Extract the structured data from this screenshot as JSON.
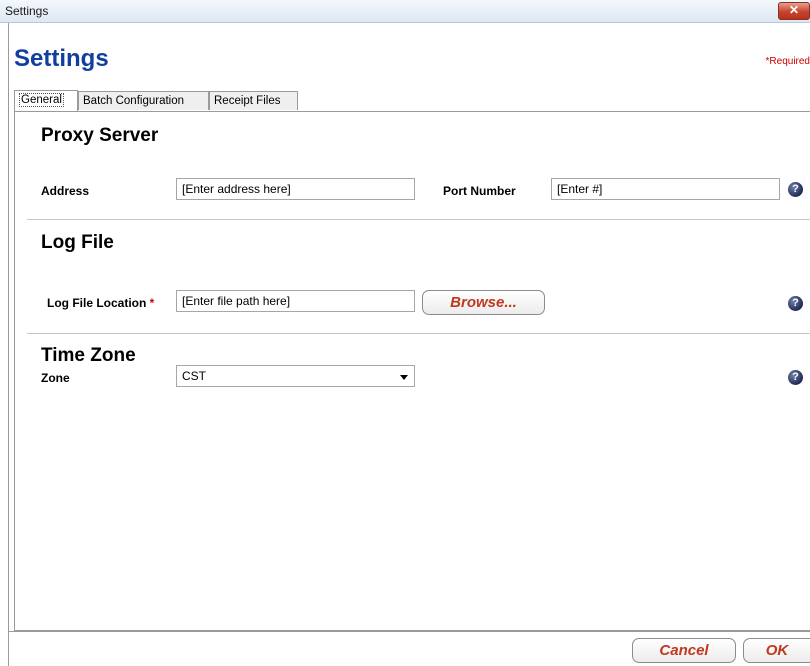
{
  "window": {
    "title": "Settings",
    "close_symbol": "✕"
  },
  "header": {
    "title": "Settings",
    "required_note": "*Required"
  },
  "tabs": [
    {
      "label": "General",
      "active": true
    },
    {
      "label": "Batch Configuration",
      "active": false
    },
    {
      "label": "Receipt Files",
      "active": false
    }
  ],
  "proxy": {
    "title": "Proxy Server",
    "address_label": "Address",
    "address_placeholder": "[Enter address here]",
    "port_label": "Port Number",
    "port_placeholder": "[Enter #]"
  },
  "log": {
    "title": "Log File",
    "location_label": "Log File Location",
    "required_mark": "*",
    "location_placeholder": "[Enter file path here]",
    "browse_label": "Browse..."
  },
  "timezone": {
    "title": "Time Zone",
    "zone_label": "Zone",
    "zone_value": "CST"
  },
  "help_icon_glyph": "?",
  "footer": {
    "cancel_label": "Cancel",
    "ok_label": "OK"
  },
  "colors": {
    "title_blue": "#113f9e",
    "accent_red": "#c0391e",
    "required_red": "#cc0000"
  }
}
